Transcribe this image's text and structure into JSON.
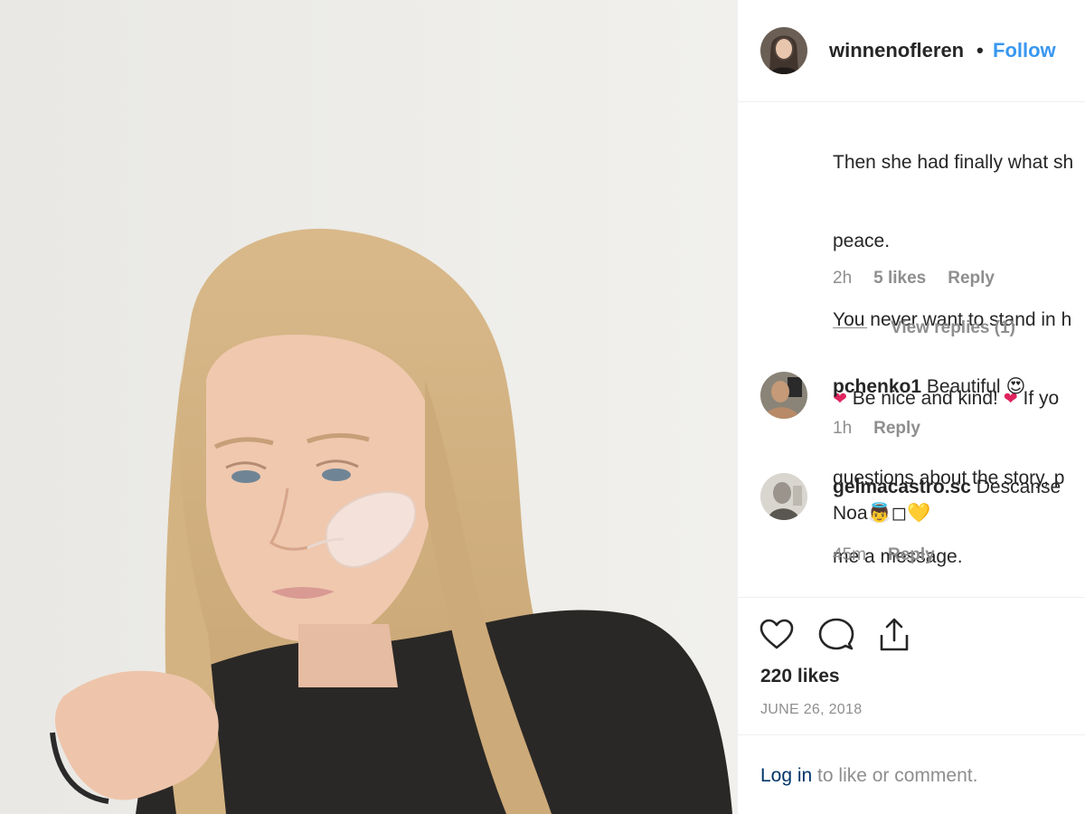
{
  "post": {
    "username": "winnenofleren",
    "separator": "•",
    "follow_label": "Follow"
  },
  "caption": {
    "lines": [
      "Then she had finally what sh",
      "peace.",
      "You never want to stand in h",
      "Be nice and kind!",
      "If yo",
      "questions about the story, p",
      "me a message."
    ],
    "time": "2h",
    "likes": "5 likes",
    "reply_label": "Reply",
    "view_replies": "View replies (1)"
  },
  "comments": [
    {
      "user": "pchenko1",
      "text": "Beautiful",
      "emoji": "😍",
      "time": "1h",
      "reply_label": "Reply"
    },
    {
      "user": "gelmacastro.sc",
      "text": "Descanse",
      "text2": "Noa",
      "emoji": "👼◻💛",
      "time": "45m",
      "reply_label": "Reply"
    }
  ],
  "actions": {
    "like_icon": "heart-icon",
    "comment_icon": "comment-icon",
    "share_icon": "share-icon",
    "likes_count": "220 likes",
    "date": "JUNE 26, 2018"
  },
  "footer": {
    "login_label": "Log in",
    "rest": " to like or comment."
  },
  "colors": {
    "link_blue": "#3897f0",
    "login_blue": "#003569",
    "muted": "#8e8e8e",
    "heart_red": "#e0245e"
  }
}
